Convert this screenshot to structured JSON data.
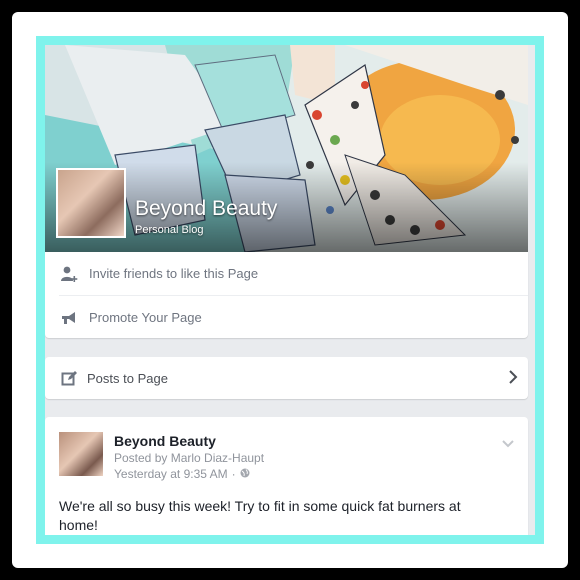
{
  "page": {
    "name": "Beyond Beauty",
    "category": "Personal Blog"
  },
  "actions": [
    {
      "label": "Invite friends to like this Page",
      "icon": "invite-friend-icon"
    },
    {
      "label": "Promote Your Page",
      "icon": "megaphone-icon"
    }
  ],
  "posts_link": {
    "label": "Posts to Page",
    "icon": "compose-icon"
  },
  "post": {
    "author": "Beyond Beauty",
    "posted_by": "Posted by Marlo Diaz-Haupt",
    "time": "Yesterday at 9:35 AM",
    "separator": "·",
    "privacy_icon": "globe-icon",
    "text": "We're all so busy this week!  Try to fit in some quick fat burners at home!"
  },
  "colors": {
    "frame_outer": "#000000",
    "frame_accent": "#7ff3ec",
    "background": "#e9ebee",
    "text_secondary": "#90949c"
  }
}
